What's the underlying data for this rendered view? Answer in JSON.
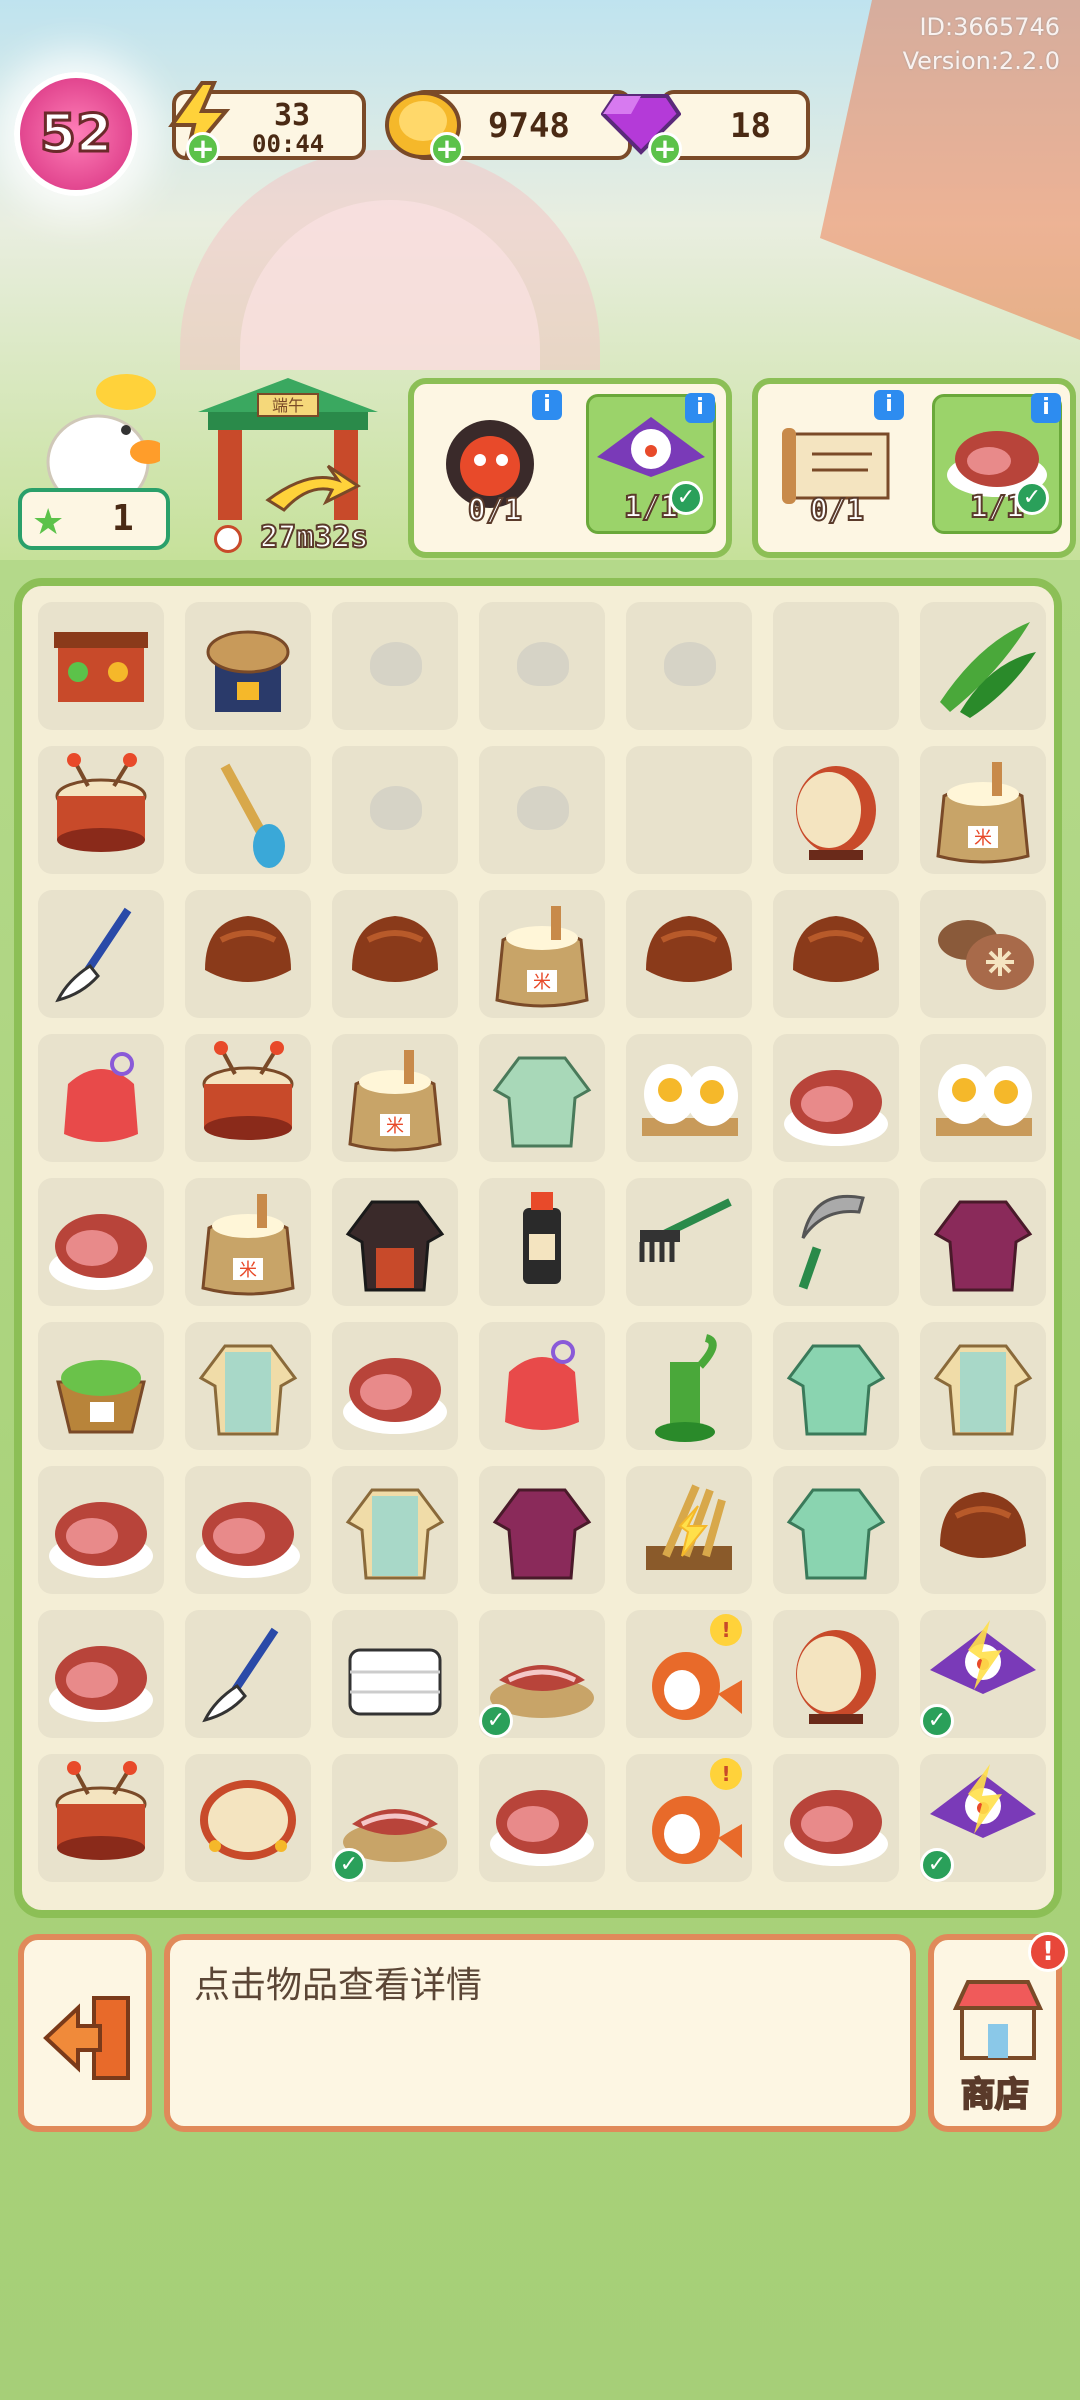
{
  "header": {
    "player_id": "ID:3665746",
    "version": "Version:2.2.0",
    "level": "52"
  },
  "resources": {
    "energy": {
      "value": "33",
      "timer": "00:44",
      "icon": "lightning-icon"
    },
    "coins": {
      "value": "9748",
      "icon": "coin-icon"
    },
    "gems": {
      "value": "18",
      "icon": "gem-icon"
    }
  },
  "stars": {
    "value": "1"
  },
  "event": {
    "timer": "27m32s",
    "sign": "端午"
  },
  "orders": [
    {
      "slots": [
        {
          "icon": "spirit-mask",
          "count": "0/1",
          "done": false
        },
        {
          "icon": "bird-kite",
          "count": "1/1",
          "done": true
        }
      ]
    },
    {
      "slots": [
        {
          "icon": "scroll",
          "count": "0/1",
          "done": false
        },
        {
          "icon": "ham",
          "count": "1/1",
          "done": true
        }
      ]
    }
  ],
  "board": {
    "rows": [
      [
        "stall",
        "stove",
        "locked",
        "locked",
        "locked",
        "empty",
        "leaves"
      ],
      [
        "drum",
        "paddle",
        "locked",
        "locked",
        "empty",
        "drum-big",
        "rice-sack"
      ],
      [
        "brush",
        "chestnut",
        "chestnut",
        "rice-sack",
        "chestnut",
        "chestnut",
        "mushroom"
      ],
      [
        "sachet",
        "drum",
        "rice-sack",
        "robe-green",
        "eggs",
        "ham",
        "eggs"
      ],
      [
        "ham",
        "rice-sack",
        "robe-black",
        "ink",
        "rake",
        "sickle",
        "robe-purple"
      ],
      [
        "zongzi-basket",
        "robe-beige",
        "ham",
        "sachet",
        "grinder",
        "robe-mint",
        "robe-beige"
      ],
      [
        "ham",
        "ham",
        "robe-beige",
        "robe-purple",
        "wheat",
        "robe-mint",
        "chestnut"
      ],
      [
        "ham",
        "brush",
        "cloth",
        "bacon-plate",
        "koi",
        "drum-big",
        "kite"
      ],
      [
        "drum",
        "tambourine",
        "bacon-plate",
        "ham",
        "koi",
        "ham",
        "kite"
      ]
    ]
  },
  "info_text": "点击物品查看详情",
  "shop": {
    "label": "商店",
    "alert": "!"
  },
  "colors": {
    "frame_green": "#8cbf56",
    "frame_orange": "#e08a5a",
    "panel_cream": "#fdf6e3",
    "pink_level": "#e2468f"
  }
}
